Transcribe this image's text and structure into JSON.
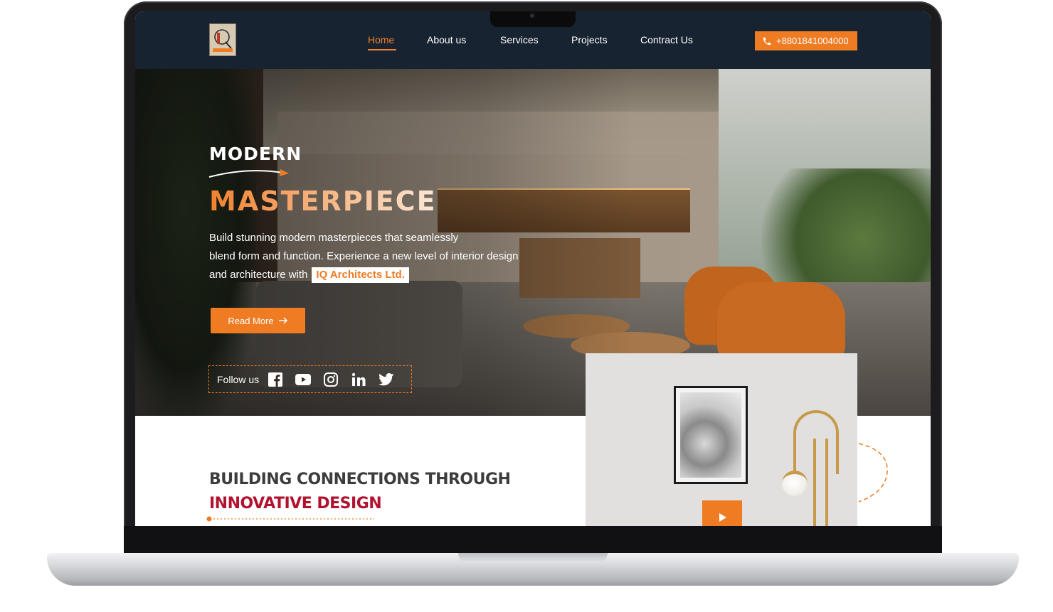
{
  "header": {
    "logo_icon": "iq-architects-logo",
    "nav": [
      {
        "label": "Home",
        "active": true
      },
      {
        "label": "About us",
        "active": false
      },
      {
        "label": "Services",
        "active": false
      },
      {
        "label": "Projects",
        "active": false
      },
      {
        "label": "Contract Us",
        "active": false
      }
    ],
    "phone": "+8801841004000",
    "phone_icon": "phone-icon"
  },
  "hero": {
    "kicker": "MODERN",
    "title": "MASTERPIECE",
    "description_lines": [
      "Build stunning modern masterpieces that seamlessly",
      "blend form and function. Experience a new level of interior design",
      "and architecture with"
    ],
    "brand": "IQ Architects Ltd.",
    "read_more": "Read More",
    "follow_label": "Follow us",
    "socials": [
      "facebook-icon",
      "youtube-icon",
      "instagram-icon",
      "linkedin-icon",
      "twitter-icon"
    ]
  },
  "section": {
    "title": "BUILDING CONNECTIONS THROUGH",
    "subtitle": "INNOVATIVE DESIGN",
    "video_icon": "play-icon"
  },
  "colors": {
    "accent": "#ef7b22",
    "header_bg": "#172330",
    "subtitle": "#b3122e",
    "heading": "#3d3d3d"
  }
}
